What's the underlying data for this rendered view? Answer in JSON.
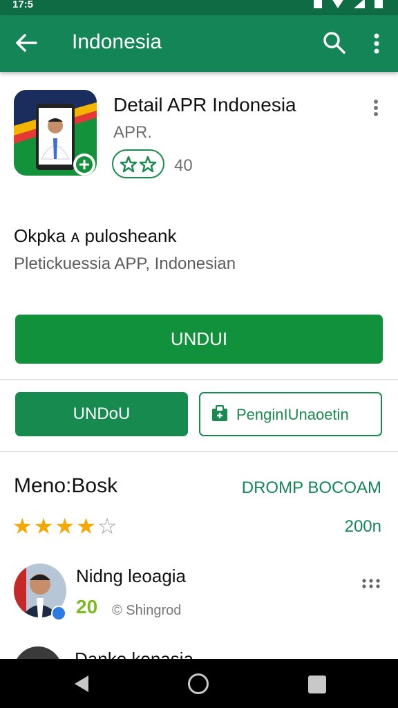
{
  "status_bar": {
    "time": "17:5"
  },
  "app_bar": {
    "title": "Indonesia"
  },
  "app": {
    "name": "Detail APR Indonesia",
    "developer": "APR.",
    "rating_count": "40",
    "description_title": "Okpka ᴀ pulosheank",
    "description_subtitle": "Pletickuessia APP, Indonesian"
  },
  "actions": {
    "install_label": "UNDUI",
    "open_label": "UNDoU",
    "wishlist_label": "PenginIUnaoetin"
  },
  "reviews": {
    "title": "Meno:Bosk",
    "link_label": "DROMP BOCOAM",
    "stars": 4,
    "total": "200n",
    "items": [
      {
        "name": "Nidng leoagia",
        "score": "20",
        "meta": "© Shingrod"
      },
      {
        "name": "Danko konasia"
      }
    ]
  },
  "colors": {
    "primary": "#138557",
    "install": "#12913d",
    "star": "#f4a900",
    "score": "#7cbb23"
  },
  "icons": [
    "back-arrow-icon",
    "search-icon",
    "more-vert-icon",
    "star-icon",
    "bookmark-icon",
    "more-horiz-icon",
    "verified-icon",
    "nav-back-icon",
    "nav-home-icon",
    "nav-recent-icon"
  ]
}
